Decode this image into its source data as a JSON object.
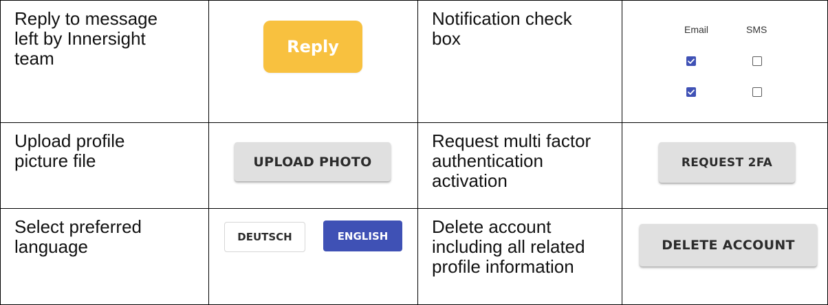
{
  "rows": [
    {
      "left_desc": [
        "Reply to message",
        "left by Innersight",
        "team"
      ],
      "reply_button": "Reply",
      "right_desc": [
        "Notification check",
        "box"
      ],
      "notifications": {
        "columns": [
          "Email",
          "SMS"
        ],
        "rows": [
          {
            "email": true,
            "sms": false
          },
          {
            "email": true,
            "sms": false
          }
        ]
      }
    },
    {
      "left_desc": [
        "Upload profile",
        "picture file"
      ],
      "upload_button": "UPLOAD PHOTO",
      "right_desc": [
        "Request multi factor",
        "authentication",
        "activation"
      ],
      "twofa_button": "REQUEST 2FA"
    },
    {
      "left_desc": [
        "Select preferred",
        "language"
      ],
      "language_options": [
        "DEUTSCH",
        "ENGLISH"
      ],
      "selected_language": "ENGLISH",
      "right_desc": [
        "Delete account",
        "including all related",
        "profile information"
      ],
      "delete_button": "DELETE ACCOUNT"
    }
  ],
  "colors": {
    "reply": "#f8c13f",
    "primary": "#3f51b5",
    "gray_button": "#e0e0e0"
  }
}
